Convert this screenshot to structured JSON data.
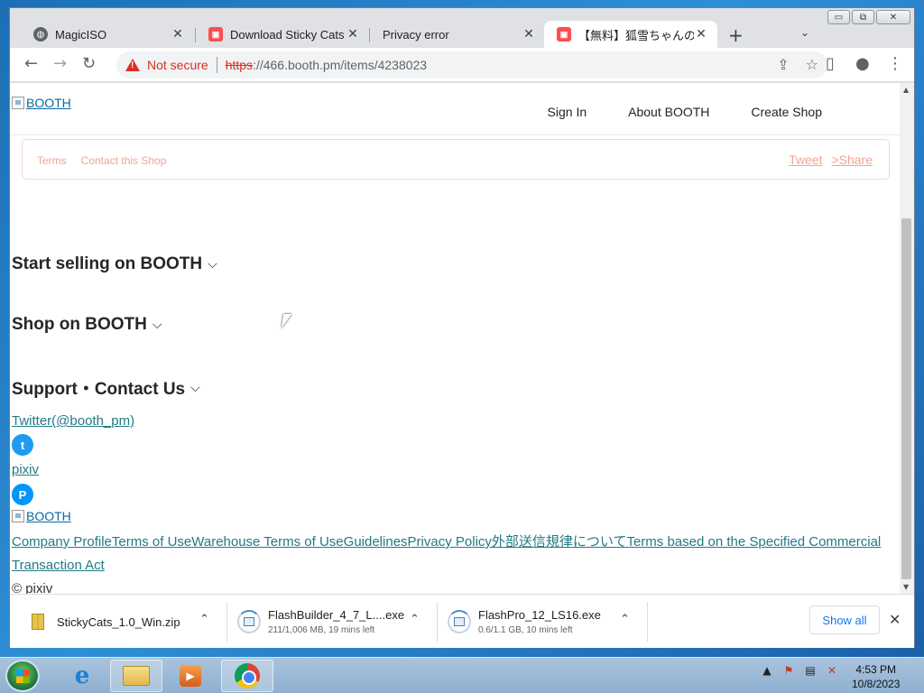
{
  "window": {
    "controls": {
      "minimize": "▭",
      "restore": "⧉",
      "close": "✕"
    }
  },
  "tabs": [
    {
      "title": "MagicISO",
      "icon": "globe-icon",
      "close": "✕"
    },
    {
      "title": "Download Sticky Cats by",
      "icon": "booth-icon",
      "close": "✕"
    },
    {
      "title": "Privacy error",
      "icon": "",
      "close": "✕"
    },
    {
      "title": "【無料】狐雪ちゃんの動くマ",
      "icon": "booth-icon",
      "close": "✕",
      "active": true
    }
  ],
  "tabstrip": {
    "new_tab": "+",
    "tab_search": "⌄"
  },
  "toolbar": {
    "back": "←",
    "forward": "→",
    "reload": "↻",
    "security_label": "Not secure",
    "url_scheme": "https",
    "url_rest": "://466.booth.pm/items/4238023",
    "share": "⇪",
    "bookmark": "☆",
    "sidepanel": "▯",
    "profile": "●",
    "menu": "⋮"
  },
  "page": {
    "header": {
      "logo_alt": "BOOTH",
      "links": [
        "Sign In",
        "About BOOTH",
        "Create Shop"
      ]
    },
    "share_bar": {
      "left": [
        "Terms",
        "Contact this Shop"
      ],
      "right": [
        "Tweet",
        ">Share"
      ]
    },
    "footer": {
      "sections": [
        "Start selling on BOOTH",
        "Shop on BOOTH",
        "Support・Contact Us"
      ],
      "chevron": "⌵",
      "twitter_label": "Twitter(@booth_pm)",
      "pixiv_label": "pixiv",
      "twitter_glyph": "t",
      "pixiv_glyph": "P",
      "footer_logo_alt": "BOOTH",
      "links": [
        "Company Profile",
        "Terms of Use",
        "Warehouse Terms of Use",
        "Guidelines",
        "Privacy Policy",
        "外部送信規律について",
        "Terms based on the Specified Commercial Transaction Act"
      ],
      "copyright": "© pixiv"
    }
  },
  "downloads": {
    "items": [
      {
        "name": "StickyCats_1.0_Win.zip",
        "status": ""
      },
      {
        "name": "FlashBuilder_4_7_L....exe",
        "status": "211/1,006 MB, 19 mins left"
      },
      {
        "name": "FlashPro_12_LS16.exe",
        "status": "0.6/1.1 GB, 10 mins left"
      }
    ],
    "caret": "⌃",
    "show_all": "Show all",
    "close": "✕"
  },
  "taskbar": {
    "tray_arrow": "▲",
    "time": "4:53 PM",
    "date": "10/8/2023"
  },
  "colors": {
    "accent_link": "#227a84",
    "warning": "#d93025",
    "booth_red": "#fc4d50"
  }
}
